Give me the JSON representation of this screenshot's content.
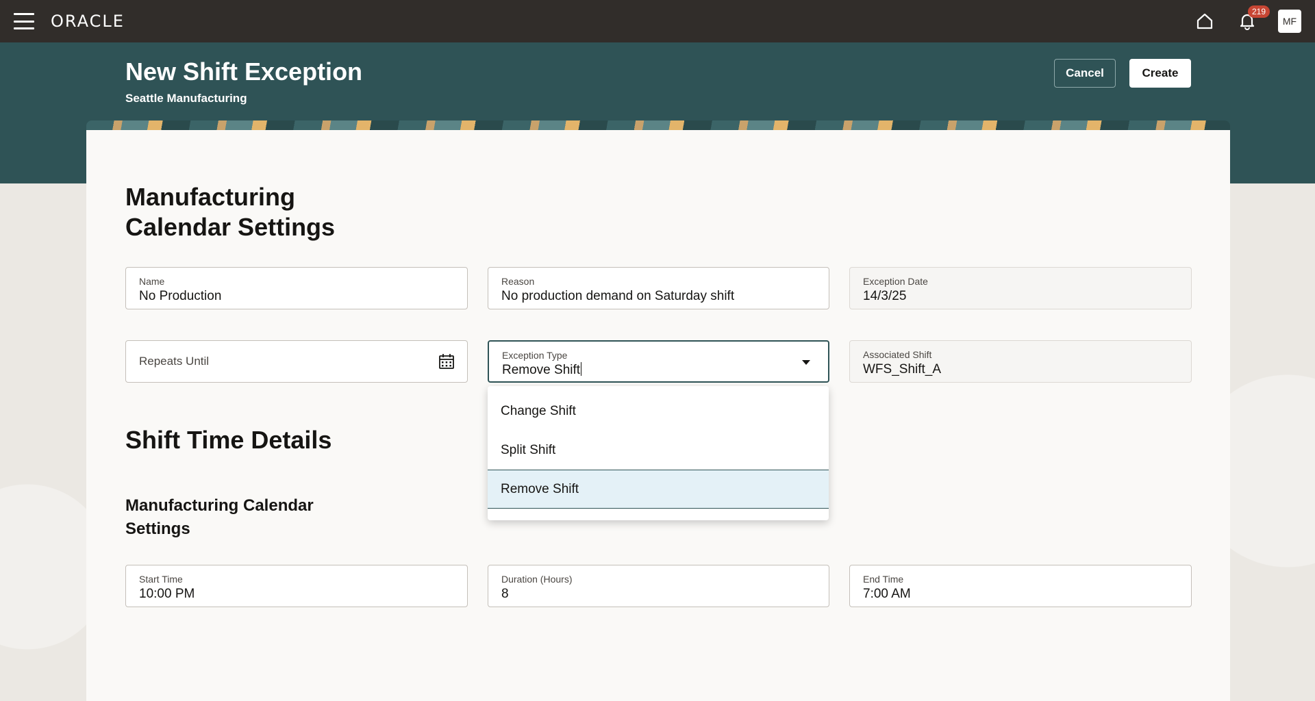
{
  "topbar": {
    "logo": "ORACLE",
    "notification_count": "219",
    "avatar_initials": "MF"
  },
  "header": {
    "title": "New Shift Exception",
    "subtitle": "Seattle Manufacturing",
    "cancel_label": "Cancel",
    "create_label": "Create"
  },
  "section1": {
    "title": "Manufacturing Calendar Settings",
    "fields": {
      "name": {
        "label": "Name",
        "value": "No Production"
      },
      "reason": {
        "label": "Reason",
        "value": "No production demand on Saturday shift"
      },
      "exception_date": {
        "label": "Exception Date",
        "value": "14/3/25"
      },
      "repeats_until": {
        "label": "Repeats Until"
      },
      "exception_type": {
        "label": "Exception Type",
        "value": "Remove Shift"
      },
      "associated_shift": {
        "label": "Associated Shift",
        "value": "WFS_Shift_A"
      }
    }
  },
  "dropdown": {
    "options": [
      "Change Shift",
      "Split Shift",
      "Remove Shift"
    ],
    "selected": "Remove Shift"
  },
  "section2": {
    "title": "Shift Time Details",
    "subtitle": "Manufacturing Calendar Settings",
    "fields": {
      "start_time": {
        "label": "Start Time",
        "value": "10:00 PM"
      },
      "duration": {
        "label": "Duration (Hours)",
        "value": "8"
      },
      "end_time": {
        "label": "End Time",
        "value": "7:00 AM"
      }
    }
  }
}
